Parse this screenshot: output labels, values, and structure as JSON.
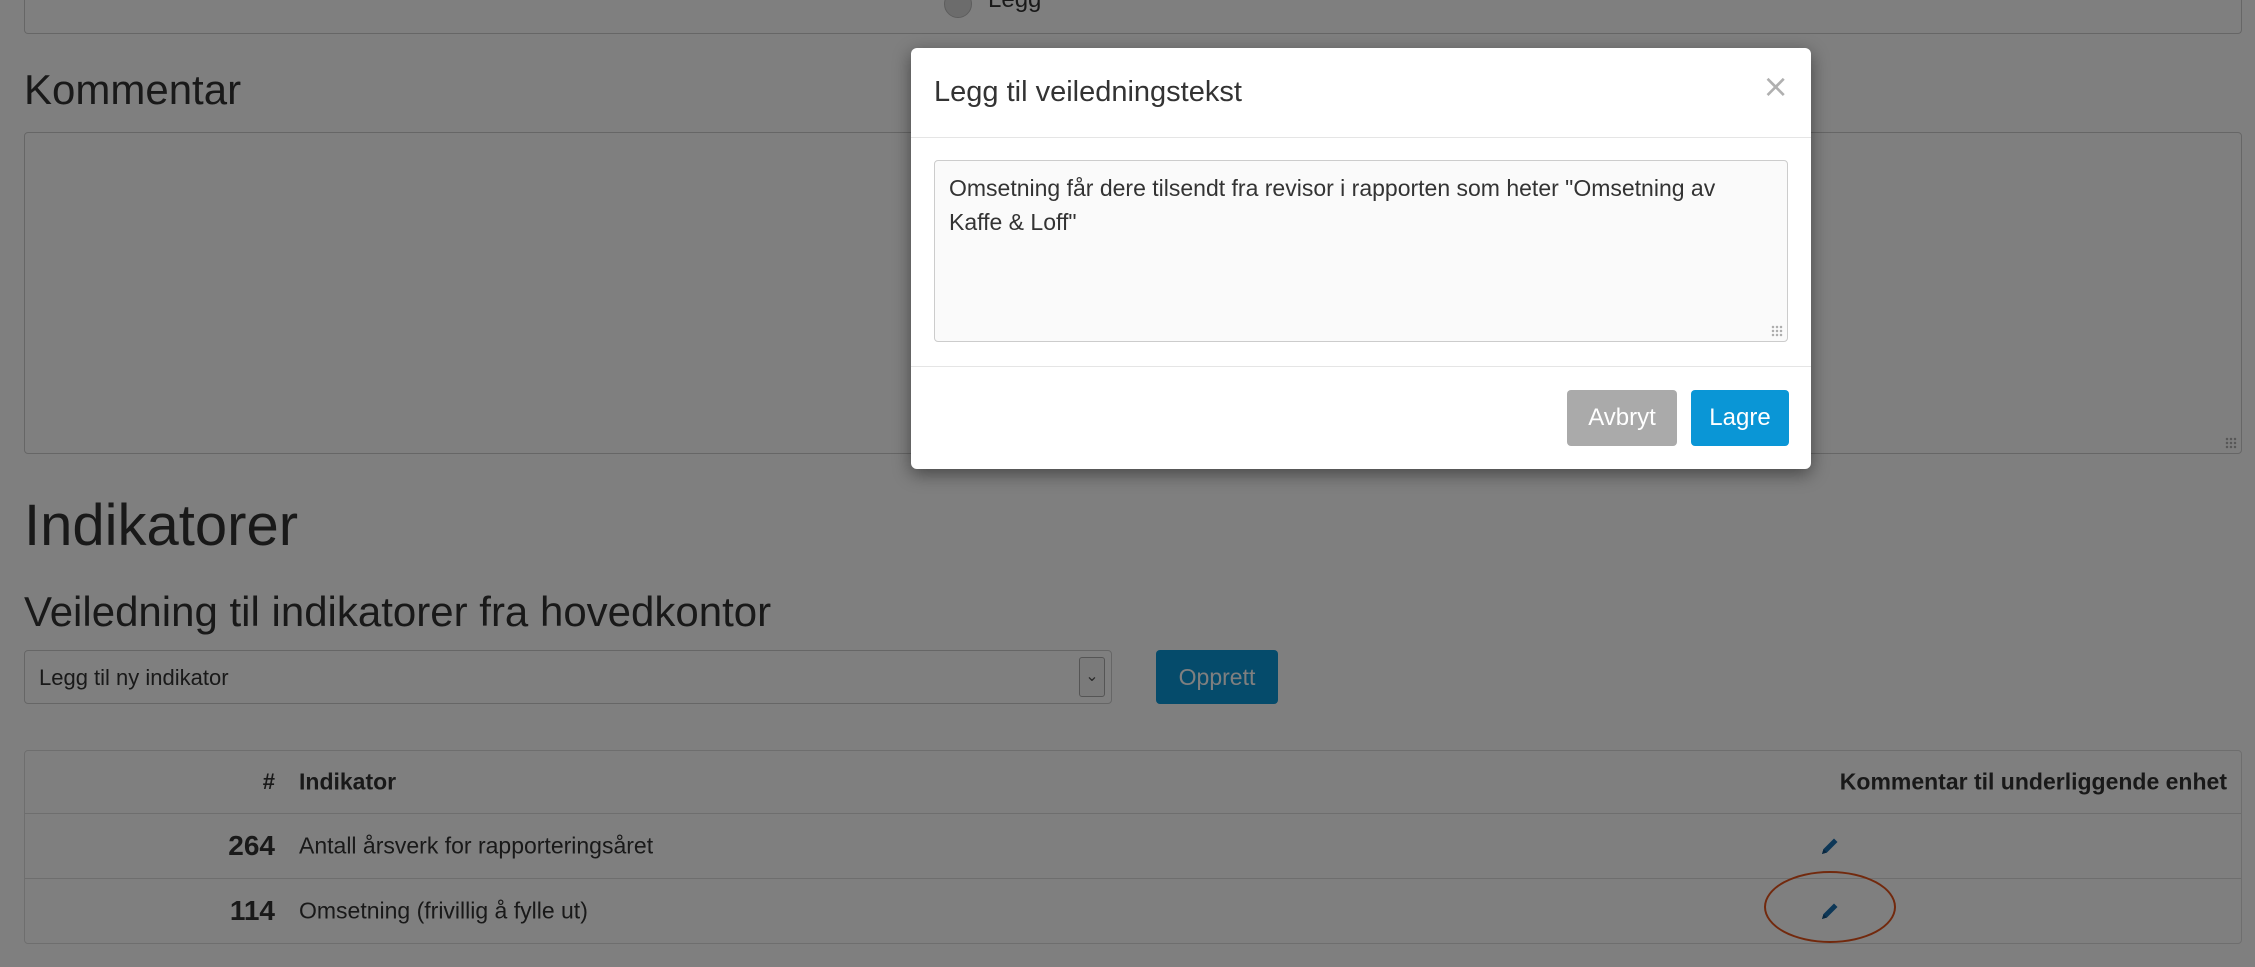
{
  "top_section": {
    "radio_label": "Legg"
  },
  "kommentar": {
    "heading": "Kommentar",
    "value": ""
  },
  "indikatorer": {
    "heading": "Indikatorer",
    "subheading": "Veiledning til indikatorer fra hovedkontor",
    "select": {
      "selected": "Legg til ny indikator",
      "arrow": "⌄"
    },
    "create_button": "Opprett",
    "table": {
      "headers": {
        "number": "#",
        "indicator": "Indikator",
        "comment": "Kommentar til underliggende enhet"
      },
      "rows": [
        {
          "number": "264",
          "indicator": "Antall årsverk for rapporteringsåret",
          "comment_icon": "pencil-icon"
        },
        {
          "number": "114",
          "indicator": "Omsetning (frivillig å fylle ut)",
          "comment_icon": "pencil-icon"
        }
      ]
    }
  },
  "modal": {
    "title": "Legg til veiledningstekst",
    "close_symbol": "×",
    "text": "Omsetning får dere tilsendt fra revisor i rapporten som heter \"Omsetning av Kaffe & Loff\"",
    "cancel_label": "Avbryt",
    "save_label": "Lagre"
  },
  "colors": {
    "primary_button": "#0a96d6",
    "cancel_button": "#aaaaaa",
    "pencil_icon": "#1a6fae",
    "highlight": "#e5521b",
    "backdrop": "rgba(0,0,0,0.5)"
  }
}
